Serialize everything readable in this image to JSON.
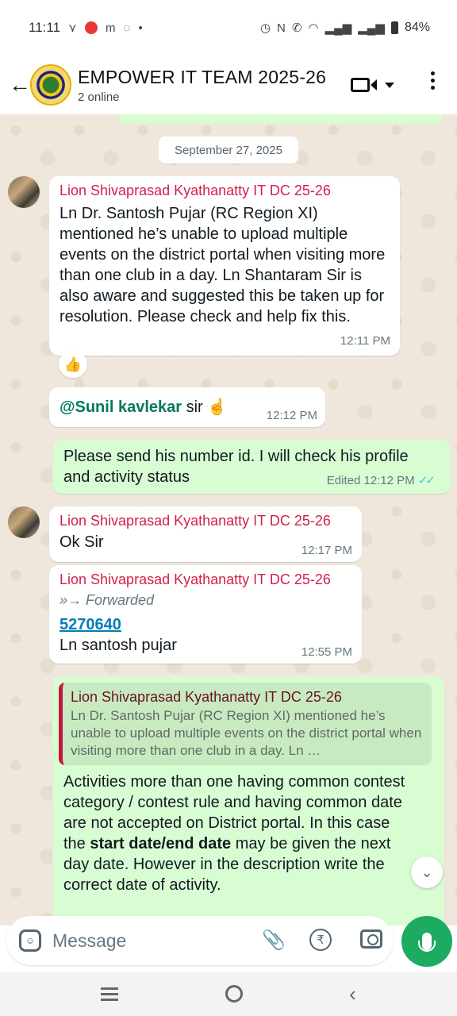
{
  "status_bar": {
    "time": "11:11",
    "battery": "84%"
  },
  "header": {
    "title": "EMPOWER IT TEAM 2025-26",
    "subtitle": "2 online"
  },
  "date_separator": "September 27, 2025",
  "messages": [
    {
      "sender": "Lion Shivaprasad Kyathanatty IT DC 25-26",
      "text": "Ln Dr. Santosh Pujar (RC Region XI) mentioned he’s unable to upload multiple events on the district portal when visiting more than one club in a day. Ln Shantaram Sir is also aware and suggested this be taken up for resolution. Please check and help fix this.",
      "time": "12:11 PM",
      "reaction": "👍"
    },
    {
      "mention": "@Sunil kavlekar",
      "text": " sir ☝️",
      "time": "12:12 PM"
    },
    {
      "text": "Please send his number id. I will check his profile and activity status",
      "time": "Edited 12:12 PM",
      "ticks": "✓✓"
    },
    {
      "sender": "Lion Shivaprasad Kyathanatty IT DC 25-26",
      "text": "Ok Sir",
      "time": "12:17 PM"
    },
    {
      "sender": "Lion Shivaprasad Kyathanatty IT DC 25-26",
      "forwarded": "Forwarded",
      "link": "5270640",
      "text": "Ln santosh pujar",
      "time": "12:55 PM"
    },
    {
      "quote_sender": "Lion Shivaprasad Kyathanatty IT DC 25-26",
      "quote_text": "Ln Dr. Santosh Pujar (RC Region XI) mentioned he’s unable to upload multiple events on the district portal when visiting more than one club in a day. Ln …",
      "text_before": "Activities more than one having common contest category / contest rule and having common date are not accepted on District portal. In this case the ",
      "text_bold": "start date/end date",
      "text_after": "  may be given the next day date.  However in the description write the correct date of activity."
    }
  ],
  "composer": {
    "placeholder": "Message"
  },
  "icons": {
    "back": "back-arrow-icon",
    "video": "video-call-icon",
    "menu": "more-options-icon",
    "emoji": "sticker-icon",
    "attach": "paperclip-icon",
    "payment": "rupee-icon",
    "camera": "camera-icon",
    "mic": "mic-icon"
  },
  "colors": {
    "sender_name": "#d21f4a",
    "outgoing_bubble": "#d9fdd3",
    "incoming_bubble": "#ffffff",
    "mic_button": "#1daa61",
    "mention": "#027a5c",
    "link": "#027eb5"
  }
}
